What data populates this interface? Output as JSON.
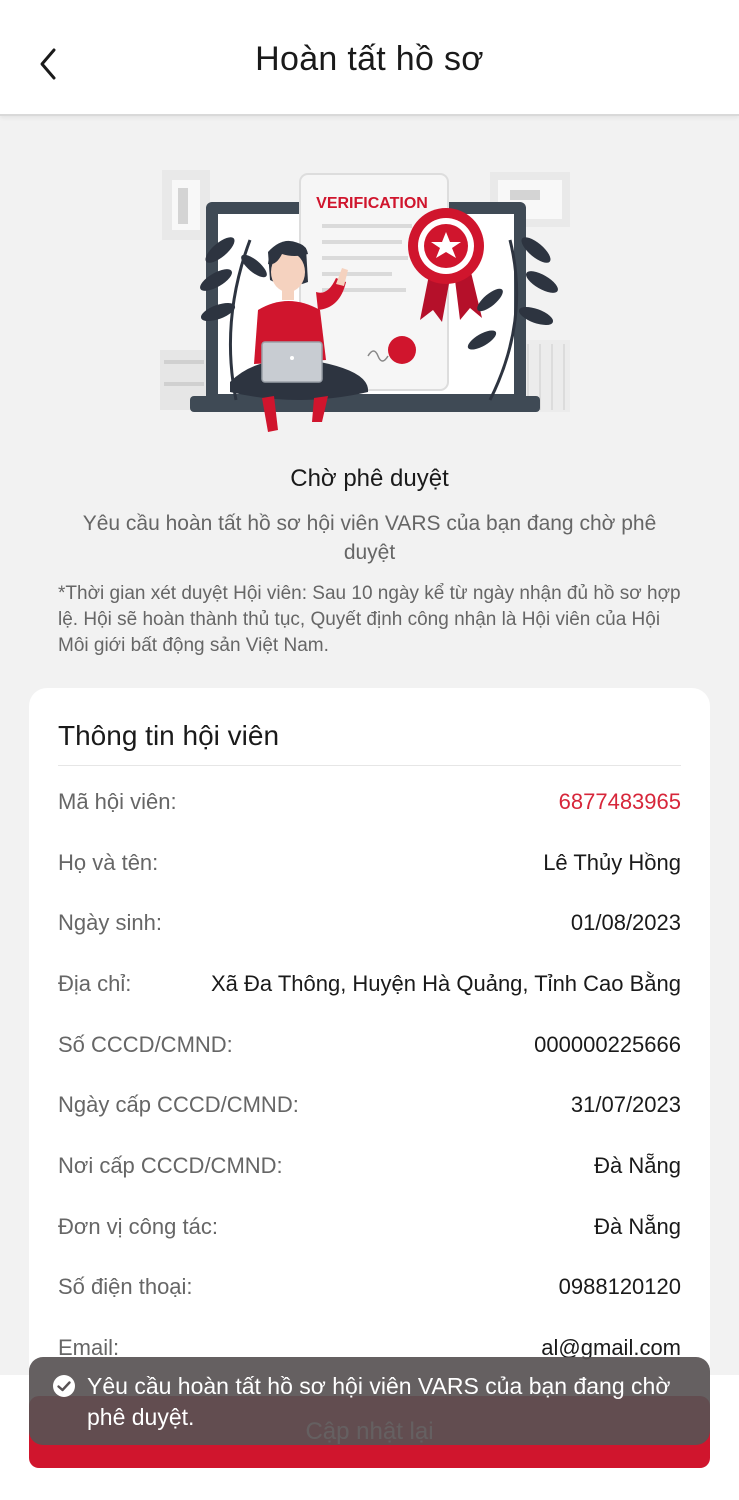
{
  "header": {
    "title": "Hoàn tất hồ sơ",
    "back_icon": "chevron-left-icon"
  },
  "illustration": {
    "badge_text": "VERIFICATION",
    "accent_color": "#d0152d"
  },
  "status": {
    "title": "Chờ phê duyệt",
    "description": "Yêu cầu hoàn tất hồ sơ hội viên VARS của bạn đang chờ phê duyệt",
    "note": "*Thời gian xét duyệt Hội viên: Sau 10 ngày kể từ ngày nhận đủ hồ sơ hợp lệ. Hội sẽ hoàn thành thủ tục, Quyết định công nhận là Hội viên của Hội Môi giới bất động sản Việt Nam."
  },
  "member_info": {
    "title": "Thông tin hội viên",
    "rows": [
      {
        "label": "Mã hội viên:",
        "value": "6877483965"
      },
      {
        "label": "Họ và tên:",
        "value": "Lê Thủy Hồng"
      },
      {
        "label": "Ngày sinh:",
        "value": "01/08/2023"
      },
      {
        "label": "Địa chỉ:",
        "value": "Xã Đa Thông, Huyện Hà Quảng, Tỉnh Cao Bằng"
      },
      {
        "label": "Số CCCD/CMND:",
        "value": "000000225666"
      },
      {
        "label": "Ngày cấp CCCD/CMND:",
        "value": "31/07/2023"
      },
      {
        "label": "Nơi cấp CCCD/CMND:",
        "value": "Đà Nẵng"
      },
      {
        "label": "Đơn vị công tác:",
        "value": "Đà Nẵng"
      },
      {
        "label": "Số điện thoại:",
        "value": "0988120120"
      },
      {
        "label": "Email:",
        "value": "al@gmail.com"
      }
    ]
  },
  "actions": {
    "update_label": "Cập nhật lại"
  },
  "toast": {
    "icon": "check-circle-icon",
    "message": "Yêu cầu hoàn tất hồ sơ hội viên VARS của bạn đang chờ phê duyệt."
  },
  "colors": {
    "primary": "#d0152d",
    "member_id": "#d7263a"
  }
}
